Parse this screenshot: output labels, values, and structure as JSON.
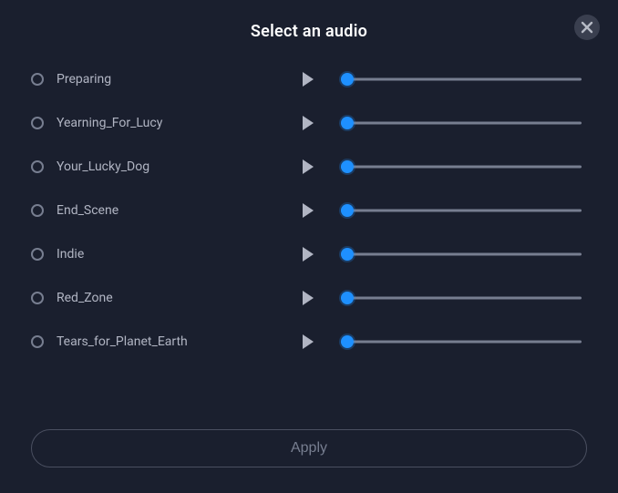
{
  "dialog": {
    "title": "Select an audio",
    "apply_label": "Apply"
  },
  "tracks": [
    {
      "name": "Preparing",
      "selected": false,
      "progress": 0
    },
    {
      "name": "Yearning_For_Lucy",
      "selected": false,
      "progress": 0
    },
    {
      "name": "Your_Lucky_Dog",
      "selected": false,
      "progress": 0
    },
    {
      "name": "End_Scene",
      "selected": false,
      "progress": 0
    },
    {
      "name": "Indie",
      "selected": false,
      "progress": 0
    },
    {
      "name": "Red_Zone",
      "selected": false,
      "progress": 0
    },
    {
      "name": "Tears_for_Planet_Earth",
      "selected": false,
      "progress": 0
    }
  ],
  "icons": {
    "close": "close-icon",
    "play": "play-icon",
    "radio": "radio-icon"
  }
}
